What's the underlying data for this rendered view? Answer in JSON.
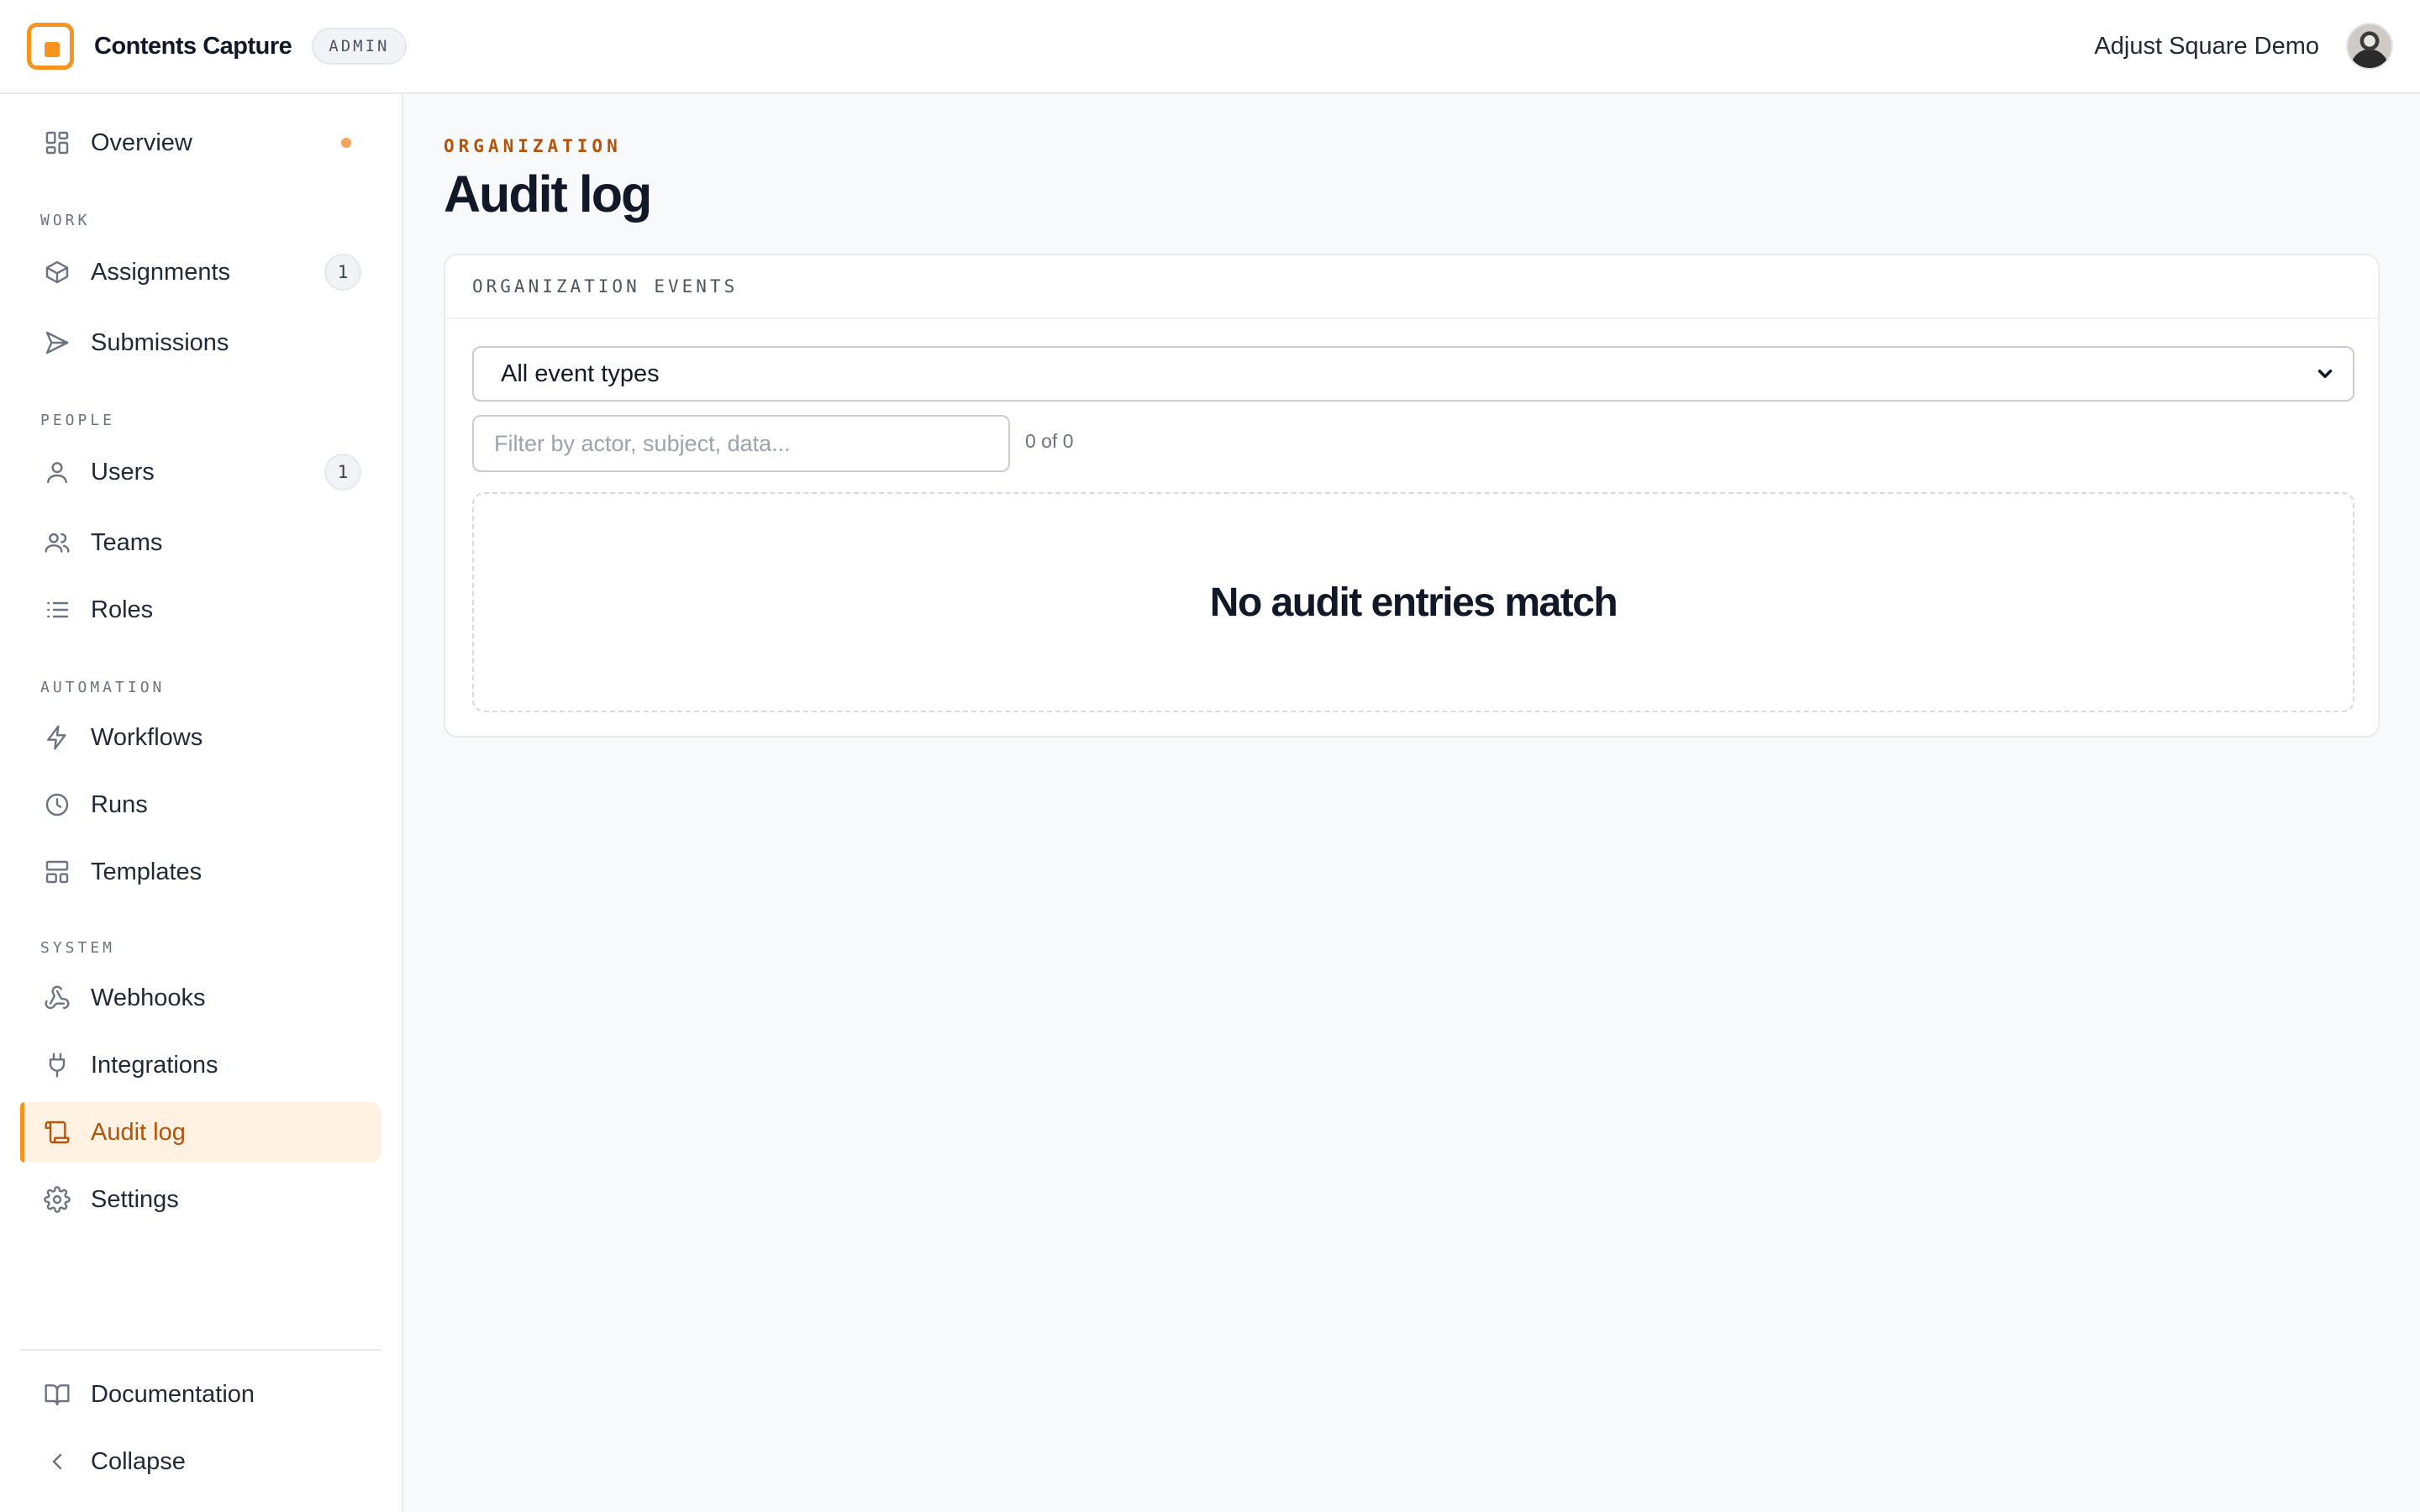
{
  "header": {
    "app_title": "Contents Capture",
    "badge": "ADMIN",
    "user_name": "Adjust Square Demo",
    "brand_color": "#f7931e"
  },
  "sidebar": {
    "overview": {
      "label": "Overview",
      "icon": "grid-icon"
    },
    "sections": {
      "work": "WORK",
      "people": "PEOPLE",
      "automation": "AUTOMATION",
      "system": "SYSTEM"
    },
    "items": {
      "assignments": {
        "label": "Assignments",
        "count": "1",
        "icon": "box-icon"
      },
      "submissions": {
        "label": "Submissions",
        "icon": "send-icon"
      },
      "users": {
        "label": "Users",
        "count": "1",
        "icon": "user-icon"
      },
      "teams": {
        "label": "Teams",
        "icon": "users-icon"
      },
      "roles": {
        "label": "Roles",
        "icon": "list-icon"
      },
      "workflows": {
        "label": "Workflows",
        "icon": "bolt-icon"
      },
      "runs": {
        "label": "Runs",
        "icon": "clock-icon"
      },
      "templates": {
        "label": "Templates",
        "icon": "layout-icon"
      },
      "webhooks": {
        "label": "Webhooks",
        "icon": "webhook-icon"
      },
      "integrations": {
        "label": "Integrations",
        "icon": "plug-icon"
      },
      "audit_log": {
        "label": "Audit log",
        "icon": "scroll-icon",
        "active": true
      },
      "settings": {
        "label": "Settings",
        "icon": "gear-icon"
      }
    },
    "footer": {
      "documentation": {
        "label": "Documentation",
        "icon": "book-icon"
      },
      "collapse": {
        "label": "Collapse",
        "icon": "chevron-left-icon"
      }
    }
  },
  "main": {
    "eyebrow": "ORGANIZATION",
    "title": "Audit log",
    "card": {
      "heading": "ORGANIZATION EVENTS",
      "event_type_select": {
        "value": "All event types"
      },
      "filter": {
        "placeholder": "Filter by actor, subject, data...",
        "value": ""
      },
      "result_count": "0 of 0",
      "empty_message": "No audit entries match"
    }
  }
}
